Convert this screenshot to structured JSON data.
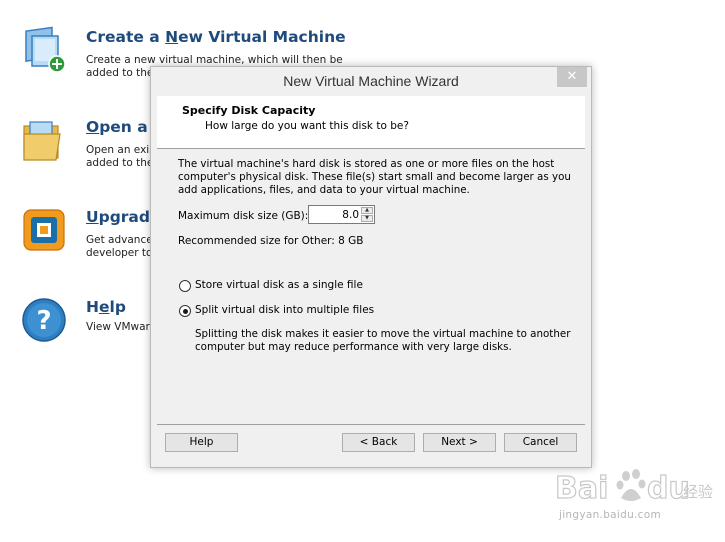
{
  "home": {
    "items": [
      {
        "title_pre": "Create a ",
        "title_key": "N",
        "title_post": "ew Virtual Machine",
        "desc1": "Create a new virtual machine, which will then be",
        "desc2": "added to the",
        "icon": "new-vm-icon"
      },
      {
        "title_pre": "",
        "title_key": "O",
        "title_post": "pen a V",
        "desc1": "Open an exist",
        "desc2": "added to the",
        "icon": "folder-vm-icon"
      },
      {
        "title_pre": "",
        "title_key": "U",
        "title_post": "pgrade",
        "desc1": "Get advanced",
        "desc2": "developer too",
        "icon": "upgrade-icon"
      },
      {
        "title_pre": "H",
        "title_key": "e",
        "title_post": "lp",
        "desc1": "View VMware",
        "desc2": "",
        "icon": "help-icon"
      }
    ]
  },
  "dialog": {
    "title": "New Virtual Machine Wizard",
    "close_label": "✕",
    "header": {
      "title": "Specify Disk Capacity",
      "subtitle": "How large do you want this disk to be?"
    },
    "body": {
      "line1": "The virtual machine's hard disk is stored as one or more files on the host",
      "line2": "computer's physical disk. These file(s) start small and become larger as you",
      "line3": "add applications, files, and data to your virtual machine."
    },
    "disk_size_label": "Maximum disk size (GB):",
    "disk_size_value": "8.0",
    "recommended": "Recommended size for Other: 8 GB",
    "option_single": "Store virtual disk as a single file",
    "option_split": "Split virtual disk into multiple files",
    "selected_option": "split",
    "split_note": {
      "line1": "Splitting the disk makes it easier to move the virtual machine to another",
      "line2": "computer but may reduce performance with very large disks."
    },
    "buttons": {
      "help": "Help",
      "back": "< Back",
      "next": "Next >",
      "cancel": "Cancel"
    }
  },
  "watermark": {
    "logo": "Baidu 经验",
    "url": "jingyan.baidu.com"
  }
}
